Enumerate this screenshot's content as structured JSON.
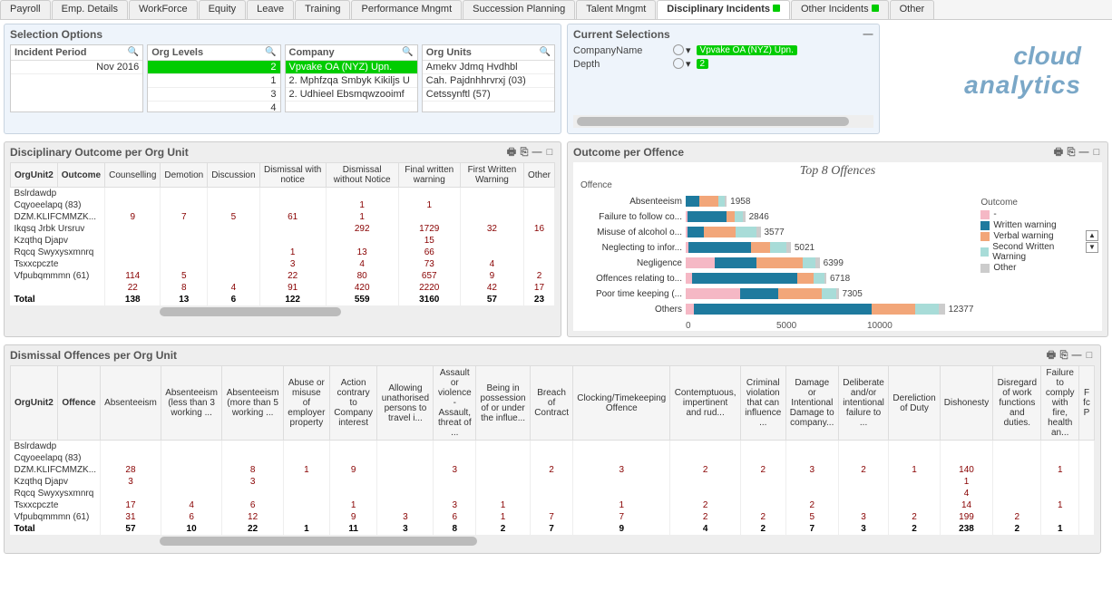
{
  "tabs": [
    "Payroll",
    "Emp. Details",
    "WorkForce",
    "Equity",
    "Leave",
    "Training",
    "Performance Mngmt",
    "Succession Planning",
    "Talent Mngmt",
    "Disciplinary Incidents",
    "Other Incidents",
    "Other"
  ],
  "active_tab": 9,
  "indicator_tabs": [
    9,
    10
  ],
  "selection_options": {
    "title": "Selection Options",
    "boxes": [
      {
        "title": "Incident Period",
        "items": [
          {
            "t": "Nov 2016",
            "sel": false,
            "right": true
          }
        ]
      },
      {
        "title": "Org Levels",
        "items": [
          {
            "t": "2",
            "sel": true,
            "right": true
          },
          {
            "t": "1",
            "sel": false,
            "right": true
          },
          {
            "t": "3",
            "sel": false,
            "right": true
          },
          {
            "t": "4",
            "sel": false,
            "right": true
          }
        ]
      },
      {
        "title": "Company",
        "items": [
          {
            "t": "Vpvake OA (NYZ) Upn.",
            "sel": true
          },
          {
            "t": "2. Mphfzqa Smbyk Kikiljs U",
            "sel": false
          },
          {
            "t": "2. Udhieel Ebsmqwzooimf",
            "sel": false
          }
        ]
      },
      {
        "title": "Org Units",
        "items": [
          {
            "t": "Amekv Jdmq Hvdhbl",
            "sel": false
          },
          {
            "t": "Cah. Pajdnhhrvrxj (03)",
            "sel": false
          },
          {
            "t": "Cetssynftl (57)",
            "sel": false
          }
        ]
      }
    ]
  },
  "current_selections": {
    "title": "Current Selections",
    "rows": [
      {
        "label": "CompanyName",
        "value": "Vpvake OA (NYZ) Upn."
      },
      {
        "label": "Depth",
        "value": "2"
      }
    ]
  },
  "logo": {
    "l1": "cloud",
    "l2": "analytics"
  },
  "table1": {
    "title": "Disciplinary Outcome per Org Unit",
    "row_head": "OrgUnit2",
    "col_head": "Outcome",
    "cols": [
      "Counselling",
      "Demotion",
      "Discussion",
      "Dismissal with notice",
      "Dismissal without Notice",
      "Final written warning",
      "First Written Warning",
      "Other"
    ],
    "rows": [
      {
        "l": "Bslrdawdp",
        "v": [
          "",
          "",
          "",
          "",
          "",
          "",
          "",
          ""
        ]
      },
      {
        "l": "Cqyoeelapq (83)",
        "v": [
          "",
          "",
          "",
          "",
          "1",
          "1",
          "",
          ""
        ]
      },
      {
        "l": "DZM.KLIFCMMZK...",
        "v": [
          "9",
          "7",
          "5",
          "61",
          "1",
          "",
          "",
          ""
        ]
      },
      {
        "l": "Ikqsq Jrbk Ursruv",
        "v": [
          "",
          "",
          "",
          "",
          "292",
          "1729",
          "32",
          "16"
        ]
      },
      {
        "l": "Kzqthq Djapv",
        "v": [
          "",
          "",
          "",
          "",
          "",
          "15",
          "",
          ""
        ]
      },
      {
        "l": "Rqcq Swyxysxmnrq",
        "v": [
          "",
          "",
          "",
          "1",
          "13",
          "66",
          "",
          ""
        ]
      },
      {
        "l": "Tsxxcpczte",
        "v": [
          "",
          "",
          "",
          "3",
          "4",
          "73",
          "4",
          ""
        ]
      },
      {
        "l": "Vfpubqmmmn (61)",
        "v": [
          "114",
          "5",
          "",
          "22",
          "80",
          "657",
          "9",
          "2"
        ]
      },
      {
        "l": "",
        "v": [
          "22",
          "8",
          "4",
          "91",
          "420",
          "2220",
          "42",
          "17"
        ]
      }
    ],
    "total": {
      "l": "Total",
      "v": [
        "138",
        "13",
        "6",
        "122",
        "559",
        "3160",
        "57",
        "23"
      ]
    }
  },
  "chart_data": {
    "title": "Outcome per Offence",
    "subtitle": "Top 8 Offences",
    "ylabel": "Offence",
    "type": "bar",
    "categories": [
      "Absenteeism",
      "Failure to follow co...",
      "Misuse of alcohol o...",
      "Neglecting to infor...",
      "Negligence",
      "Offences relating to...",
      "Poor time keeping (...",
      "Others"
    ],
    "values": [
      1958,
      2846,
      3577,
      5021,
      6399,
      6718,
      7305,
      12377
    ],
    "series": [
      {
        "name": "-",
        "values": [
          0,
          70,
          100,
          120,
          1400,
          300,
          2600,
          400
        ]
      },
      {
        "name": "Written warning",
        "values": [
          658,
          1876,
          777,
          3001,
          1999,
          5018,
          1805,
          8477
        ]
      },
      {
        "name": "Verbal warning",
        "values": [
          900,
          400,
          1500,
          900,
          2200,
          800,
          2100,
          2100
        ]
      },
      {
        "name": "Second Written Warning",
        "values": [
          300,
          400,
          1000,
          800,
          600,
          500,
          700,
          1100
        ]
      },
      {
        "name": "Other",
        "values": [
          100,
          100,
          200,
          200,
          200,
          100,
          100,
          300
        ]
      }
    ],
    "xticks": [
      0,
      5000,
      10000
    ],
    "legend_title": "Outcome",
    "legend": [
      "-",
      "Written warning",
      "Verbal warning",
      "Second Written Warning",
      "Other"
    ]
  },
  "table2": {
    "title": "Dismissal Offences per Org Unit",
    "row_head": "OrgUnit2",
    "col_head": "Offence",
    "cols": [
      "Absenteeism",
      "Absenteeism (less than 3 working ...",
      "Absenteeism (more than 5 working ...",
      "Abuse or misuse of employer property",
      "Action contrary to Company interest",
      "Allowing unathorised persons to travel i...",
      "Assault or violence - Assault, threat of ...",
      "Being in possession of or under the influe...",
      "Breach of Contract",
      "Clocking/Timekeeping Offence",
      "Contemptuous, impertinent and rud...",
      "Criminal violation that can influence ...",
      "Damage or Intentional Damage to company...",
      "Deliberate and/or intentional failure to ...",
      "Dereliction of Duty",
      "Dishonesty",
      "Disregard of work functions and duties.",
      "Failure to comply with fire, health an...",
      "F fc P"
    ],
    "rows": [
      {
        "l": "Bslrdawdp",
        "v": [
          "",
          "",
          "",
          "",
          "",
          "",
          "",
          "",
          "",
          "",
          "",
          "",
          "",
          "",
          "",
          "",
          "",
          "",
          ""
        ]
      },
      {
        "l": "Cqyoeelapq (83)",
        "v": [
          "",
          "",
          "",
          "",
          "",
          "",
          "",
          "",
          "",
          "",
          "",
          "",
          "",
          "",
          "",
          "",
          "",
          "",
          ""
        ]
      },
      {
        "l": "DZM.KLIFCMMZK...",
        "v": [
          "28",
          "",
          "8",
          "1",
          "9",
          "",
          "3",
          "",
          "2",
          "3",
          "2",
          "2",
          "3",
          "2",
          "1",
          "140",
          "",
          "1",
          ""
        ]
      },
      {
        "l": "Kzqthq Djapv",
        "v": [
          "3",
          "",
          "3",
          "",
          "",
          "",
          "",
          "",
          "",
          "",
          "",
          "",
          "",
          "",
          "",
          "1",
          "",
          "",
          ""
        ]
      },
      {
        "l": "Rqcq Swyxysxmnrq",
        "v": [
          "",
          "",
          "",
          "",
          "",
          "",
          "",
          "",
          "",
          "",
          "",
          "",
          "",
          "",
          "",
          "4",
          "",
          "",
          ""
        ]
      },
      {
        "l": "Tsxxcpczte",
        "v": [
          "17",
          "4",
          "6",
          "",
          "1",
          "",
          "3",
          "1",
          "",
          "1",
          "2",
          "",
          "2",
          "",
          "",
          "14",
          "",
          "1",
          ""
        ]
      },
      {
        "l": "Vfpubqmmmn (61)",
        "v": [
          "31",
          "6",
          "12",
          "",
          "9",
          "3",
          "6",
          "1",
          "7",
          "7",
          "2",
          "2",
          "5",
          "3",
          "2",
          "199",
          "2",
          "",
          ""
        ]
      }
    ],
    "total": {
      "l": "Total",
      "v": [
        "57",
        "10",
        "22",
        "1",
        "11",
        "3",
        "8",
        "2",
        "7",
        "9",
        "4",
        "2",
        "7",
        "3",
        "2",
        "238",
        "2",
        "1",
        ""
      ]
    }
  }
}
